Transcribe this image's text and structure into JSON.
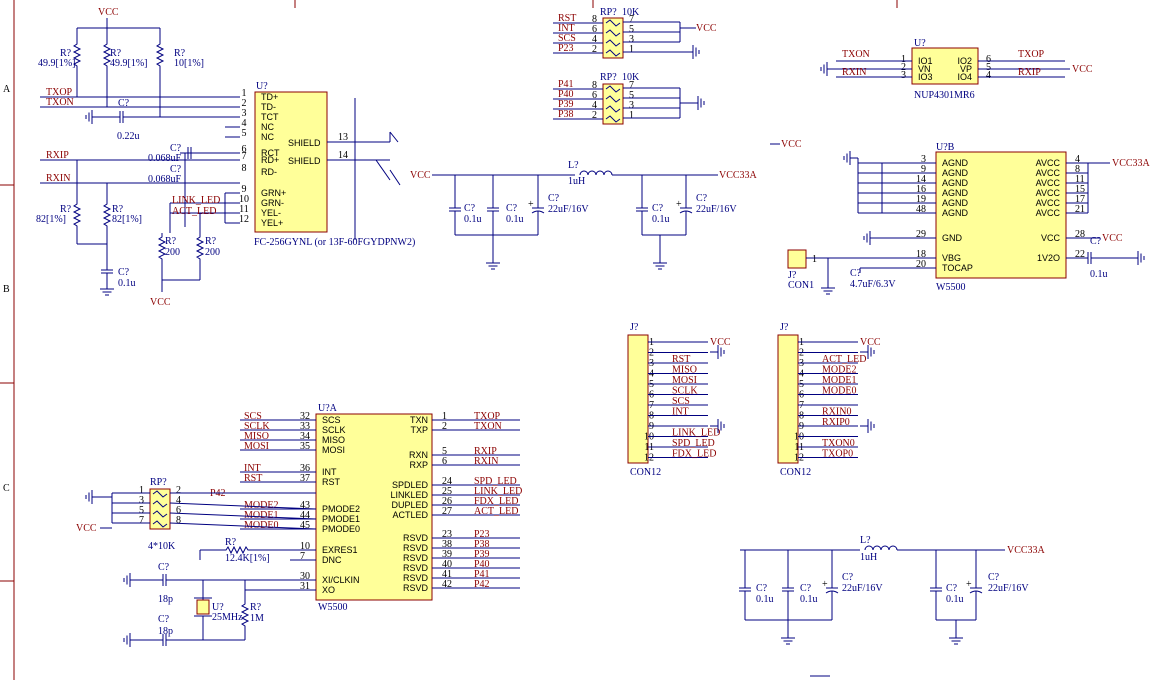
{
  "frame": {
    "rows": [
      "A",
      "B",
      "C"
    ]
  },
  "rj45": {
    "ref": "U?",
    "name": "FC-256GYNL (or 13F-60FGYDPNW2)",
    "left_pins": [
      {
        "num": "1",
        "name": "TD+"
      },
      {
        "num": "2",
        "name": "TD-"
      },
      {
        "num": "3",
        "name": "TCT"
      },
      {
        "num": "4",
        "name": "NC"
      },
      {
        "num": "5",
        "name": "NC"
      },
      {
        "num": "6",
        "name": "RCT"
      },
      {
        "num": "7",
        "name": "RD+"
      },
      {
        "num": "8",
        "name": "RD-"
      },
      {
        "num": "9",
        "name": "GRN+"
      },
      {
        "num": "10",
        "name": "GRN-"
      },
      {
        "num": "11",
        "name": "YEL-"
      },
      {
        "num": "12",
        "name": "YEL+"
      }
    ],
    "right_pins": [
      {
        "num": "13",
        "name": "SHIELD"
      },
      {
        "num": "14",
        "name": "SHIELD"
      }
    ],
    "nets_left": [
      "TXOP",
      "TXON",
      "RXIP",
      "RXIN",
      "LINK_LED",
      "ACT_LED"
    ],
    "parts": {
      "r1": "R?",
      "r1v": "49.9[1%]",
      "r2": "R?",
      "r2v": "49.9[1%]",
      "r3": "R?",
      "r3v": "10[1%]",
      "c1": "C?",
      "c1v": "0.22u",
      "c2": "C?",
      "c2v": "0.068uF",
      "c3": "C?",
      "c3v": "0.068uF",
      "r4": "R?",
      "r4v": "82[1%]",
      "r5": "R?",
      "r5v": "82[1%]",
      "c4": "C?",
      "c4v": "0.1u",
      "r6": "R?",
      "r6v": "200",
      "r7": "R?",
      "r7v": "200",
      "vcc_top": "VCC",
      "vcc_bot": "VCC"
    }
  },
  "rpacks": {
    "rp1": {
      "ref": "RP?",
      "val": "10K",
      "pins_l": [
        "8",
        "6",
        "4",
        "2"
      ],
      "pins_r": [
        "7",
        "5",
        "3",
        "1"
      ],
      "nets": [
        "RST",
        "INT",
        "SCS",
        "P23"
      ],
      "vcc": "VCC"
    },
    "rp2": {
      "ref": "RP?",
      "val": "10K",
      "pins_l": [
        "8",
        "6",
        "4",
        "2"
      ],
      "pins_r": [
        "7",
        "5",
        "3",
        "1"
      ],
      "nets": [
        "P41",
        "P40",
        "P39",
        "P38"
      ]
    },
    "rp3": {
      "ref": "RP?",
      "val": "4*10K",
      "pins_l": [
        "1",
        "3",
        "5",
        "7"
      ],
      "pins_r": [
        "2",
        "4",
        "6",
        "8"
      ],
      "net_top": "P42",
      "vcc": "VCC"
    }
  },
  "nup": {
    "ref": "U?",
    "name": "NUP4301MR6",
    "pins_l": [
      {
        "num": "1",
        "name": "IO1"
      },
      {
        "num": "2",
        "name": "VN"
      },
      {
        "num": "3",
        "name": "IO3"
      }
    ],
    "pins_r": [
      {
        "num": "6",
        "name": "IO2"
      },
      {
        "num": "5",
        "name": "VP"
      },
      {
        "num": "4",
        "name": "IO4"
      }
    ],
    "nets_l": [
      "TXON",
      "RXIN"
    ],
    "nets_r": [
      "TXOP",
      "RXIP"
    ],
    "vcc": "VCC"
  },
  "power1": {
    "vcc": "VCC",
    "vcc33": "VCC33A",
    "l": "L?",
    "lv": "1uH",
    "caps": [
      {
        "ref": "C?",
        "val": "0.1u"
      },
      {
        "ref": "C?",
        "val": "0.1u"
      },
      {
        "ref": "C?",
        "val": "22uF/16V"
      },
      {
        "ref": "C?",
        "val": "0.1u"
      },
      {
        "ref": "C?",
        "val": "22uF/16V"
      }
    ]
  },
  "power2": {
    "vcc33": "VCC33A",
    "l": "L?",
    "lv": "1uH",
    "caps": [
      {
        "ref": "C?",
        "val": "0.1u"
      },
      {
        "ref": "C?",
        "val": "0.1u"
      },
      {
        "ref": "C?",
        "val": "22uF/16V"
      },
      {
        "ref": "C?",
        "val": "0.1u"
      },
      {
        "ref": "C?",
        "val": "22uF/16V"
      }
    ]
  },
  "w5500b": {
    "ref": "U?B",
    "name": "W5500",
    "left": [
      {
        "num": "3",
        "name": "AGND"
      },
      {
        "num": "9",
        "name": "AGND"
      },
      {
        "num": "14",
        "name": "AGND"
      },
      {
        "num": "16",
        "name": "AGND"
      },
      {
        "num": "19",
        "name": "AGND"
      },
      {
        "num": "48",
        "name": "AGND"
      },
      {
        "num": "29",
        "name": "GND"
      },
      {
        "num": "18",
        "name": "VBG"
      },
      {
        "num": "20",
        "name": "TOCAP"
      }
    ],
    "right": [
      {
        "num": "4",
        "name": "AVCC"
      },
      {
        "num": "8",
        "name": "AVCC"
      },
      {
        "num": "11",
        "name": "AVCC"
      },
      {
        "num": "15",
        "name": "AVCC"
      },
      {
        "num": "17",
        "name": "AVCC"
      },
      {
        "num": "21",
        "name": "AVCC"
      },
      {
        "num": "28",
        "name": "VCC"
      },
      {
        "num": "22",
        "name": "1V2O"
      }
    ],
    "vcc": "VCC",
    "vcc33": "VCC33A",
    "vcc_left": "VCC",
    "con": {
      "ref": "J?",
      "name": "CON1",
      "pin": "1"
    },
    "c_tocap": {
      "ref": "C?",
      "val": "4.7uF/6.3V"
    },
    "c_1v2": {
      "ref": "C?",
      "val": "0.1u"
    },
    "c_vcc": {
      "ref": "C?"
    }
  },
  "w5500a": {
    "ref": "U?A",
    "name": "W5500",
    "left": [
      {
        "num": "32",
        "name": "SCS",
        "net": "SCS"
      },
      {
        "num": "33",
        "name": "SCLK",
        "net": "SCLK"
      },
      {
        "num": "34",
        "name": "MISO",
        "net": "MISO"
      },
      {
        "num": "35",
        "name": "MOSI",
        "net": "MOSI"
      },
      {
        "num": "36",
        "name": "INT",
        "net": "INT"
      },
      {
        "num": "37",
        "name": "RST",
        "net": "RST"
      },
      {
        "num": "43",
        "name": "PMODE2",
        "net": "MODE2"
      },
      {
        "num": "44",
        "name": "PMODE1",
        "net": "MODE1"
      },
      {
        "num": "45",
        "name": "PMODE0",
        "net": "MODE0"
      },
      {
        "num": "10",
        "name": "EXRES1",
        "net": ""
      },
      {
        "num": "7",
        "name": "DNC",
        "net": ""
      },
      {
        "num": "30",
        "name": "XI/CLKIN",
        "net": ""
      },
      {
        "num": "31",
        "name": "XO",
        "net": ""
      }
    ],
    "right": [
      {
        "num": "1",
        "name": "TXN",
        "net": "TXOP"
      },
      {
        "num": "2",
        "name": "TXP",
        "net": "TXON"
      },
      {
        "num": "5",
        "name": "RXN",
        "net": "RXIP"
      },
      {
        "num": "6",
        "name": "RXP",
        "net": "RXIN"
      },
      {
        "num": "24",
        "name": "SPDLED",
        "net": "SPD_LED"
      },
      {
        "num": "25",
        "name": "LINKLED",
        "net": "LINK_LED"
      },
      {
        "num": "26",
        "name": "DUPLED",
        "net": "FDX_LED"
      },
      {
        "num": "27",
        "name": "ACTLED",
        "net": "ACT_LED"
      },
      {
        "num": "23",
        "name": "RSVD",
        "net": "P23"
      },
      {
        "num": "38",
        "name": "RSVD",
        "net": "P38"
      },
      {
        "num": "39",
        "name": "RSVD",
        "net": "P39"
      },
      {
        "num": "40",
        "name": "RSVD",
        "net": "P40"
      },
      {
        "num": "41",
        "name": "RSVD",
        "net": "P41"
      },
      {
        "num": "42",
        "name": "RSVD",
        "net": "P42"
      }
    ],
    "mode_nets": [
      "MODE2",
      "MODE1",
      "MODE0"
    ],
    "vcc": "VCC",
    "r_ex": {
      "ref": "R?",
      "val": "12.4K[1%]"
    },
    "c_x1": {
      "ref": "C?",
      "val": "18p"
    },
    "c_x2": {
      "ref": "C?",
      "val": "18p"
    },
    "xtal": {
      "ref": "U?",
      "val": "25MHz"
    },
    "r_x": {
      "ref": "R?",
      "val": "1M"
    }
  },
  "con12a": {
    "ref": "J?",
    "name": "CON12",
    "pins": [
      "1",
      "2",
      "3",
      "4",
      "5",
      "6",
      "7",
      "8",
      "9",
      "10",
      "11",
      "12"
    ],
    "nets": [
      "VCC",
      "",
      "RST",
      "MISO",
      "MOSI",
      "SCLK",
      "SCS",
      "INT",
      "",
      "LINK_LED",
      "SPD_LED",
      "FDX_LED"
    ]
  },
  "con12b": {
    "ref": "J?",
    "name": "CON12",
    "pins": [
      "1",
      "2",
      "3",
      "4",
      "5",
      "6",
      "7",
      "8",
      "9",
      "10",
      "11",
      "12"
    ],
    "nets": [
      "VCC",
      "",
      "ACT_LED",
      "MODE2",
      "MODE1",
      "MODE0",
      "",
      "RXIN0",
      "RXIP0",
      "",
      "TXON0",
      "TXOP0"
    ]
  },
  "misc": {
    "vcc_float": "VCC"
  },
  "colors": {
    "wire": "#000080",
    "chip_fill": "#ffff99",
    "chip_border": "#8b0000",
    "net_text": "#8b0000"
  }
}
